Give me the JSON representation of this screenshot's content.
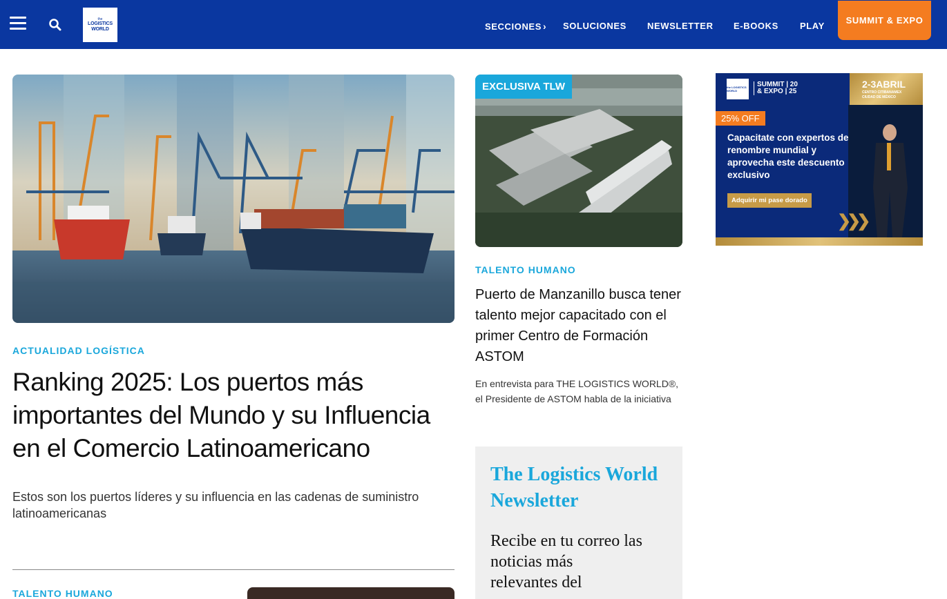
{
  "header": {
    "logo": {
      "line1": "the",
      "line2": "LOGISTICS",
      "line3": "WORLD"
    },
    "nav": {
      "secciones": "SECCIONES",
      "soluciones": "SOLUCIONES",
      "newsletter": "NEWSLETTER",
      "ebooks": "E-BOOKS",
      "play": "PLAY",
      "summit": "SUMMIT & EXPO"
    },
    "colors": {
      "bar": "#0a37a0",
      "summit": "#f47c20"
    }
  },
  "main_article": {
    "category": "ACTUALIDAD LOGÍSTICA",
    "title": "Ranking 2025: Los puertos más importantes del Mundo y su Influencia en el Comercio Latinoamericano",
    "description": "Estos son los puertos líderes y su influencia en las cadenas de suministro latinoamericanas",
    "image": "port-with-cranes-and-ships"
  },
  "next_article": {
    "category": "TALENTO HUMANO"
  },
  "side_article": {
    "badge": "EXCLUSIVA TLW",
    "category": "TALENTO HUMANO",
    "title": "Puerto de Manzanillo busca tener talento mejor capacitado con el primer Centro de Formación ASTOM",
    "description": "En entrevista para THE LOGISTICS WORLD®, el Presidente de ASTOM habla de la iniciativa",
    "image": "aerial-port-warehouses-ship"
  },
  "newsletter": {
    "title": "The Logistics World Newsletter",
    "body": "Recibe en tu correo las noticias más relevantes del"
  },
  "ad": {
    "logo": "the LOGISTICS WORLD",
    "summit": "SUMMIT | 20",
    "expo": "& EXPO | 25",
    "date": "2-3ABRIL",
    "venue_line1": "CENTRO CITIBANAMEX",
    "venue_line2": "CIUDAD DE MÉXICO",
    "discount": "25% OFF",
    "text": "Capacitate con expertos de renombre mundial y aprovecha este descuento exclusivo",
    "cta": "Adquirir mi pase dorado",
    "arrows": "❯❯❯"
  },
  "accent_color": "#1aa7db"
}
